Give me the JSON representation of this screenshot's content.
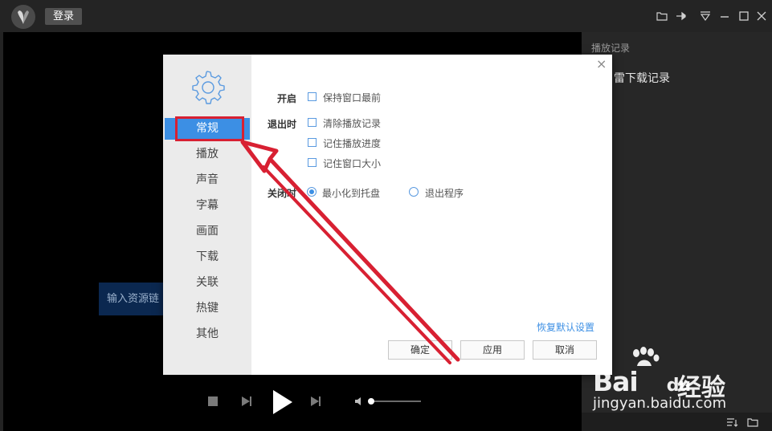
{
  "header": {
    "login_label": "登录"
  },
  "playlist": {
    "title": "播放记录",
    "items": [
      "雷下载记录"
    ]
  },
  "video": {
    "url_placeholder": "输入资源链"
  },
  "settings": {
    "nav": [
      "常规",
      "播放",
      "声音",
      "字幕",
      "画面",
      "下载",
      "关联",
      "热键",
      "其他"
    ],
    "active_nav": "常规",
    "sections": {
      "open_label": "开启",
      "exit_label": "退出时",
      "close_label": "关闭时"
    },
    "options": {
      "keep_on_top": {
        "label": "保持窗口最前",
        "checked": false
      },
      "clear_history": {
        "label": "清除播放记录",
        "checked": false
      },
      "remember_progress": {
        "label": "记住播放进度",
        "checked": false
      },
      "remember_size": {
        "label": "记住窗口大小",
        "checked": false
      }
    },
    "close_options": [
      {
        "label": "最小化到托盘",
        "selected": true
      },
      {
        "label": "退出程序",
        "selected": false
      }
    ],
    "restore_defaults": "恢复默认设置",
    "buttons": {
      "ok": "确定",
      "apply": "应用",
      "cancel": "取消"
    },
    "close_symbol": "×"
  },
  "watermark": {
    "brand": "Bai",
    "brand_suffix": "du",
    "cn": "经验",
    "url": "jingyan.baidu.com"
  },
  "colors": {
    "accent": "#3c8fe4",
    "annotation_red": "#d82032"
  },
  "icons": {
    "titlebar": [
      "folder-icon",
      "pin-icon",
      "menu-icon",
      "minimize-icon",
      "maximize-icon",
      "close-icon"
    ],
    "controls": [
      "stop-icon",
      "previous-icon",
      "play-icon",
      "next-icon",
      "volume-icon"
    ],
    "bottom": [
      "sort-list-icon",
      "folder-icon"
    ]
  },
  "volume_level": 0.08
}
